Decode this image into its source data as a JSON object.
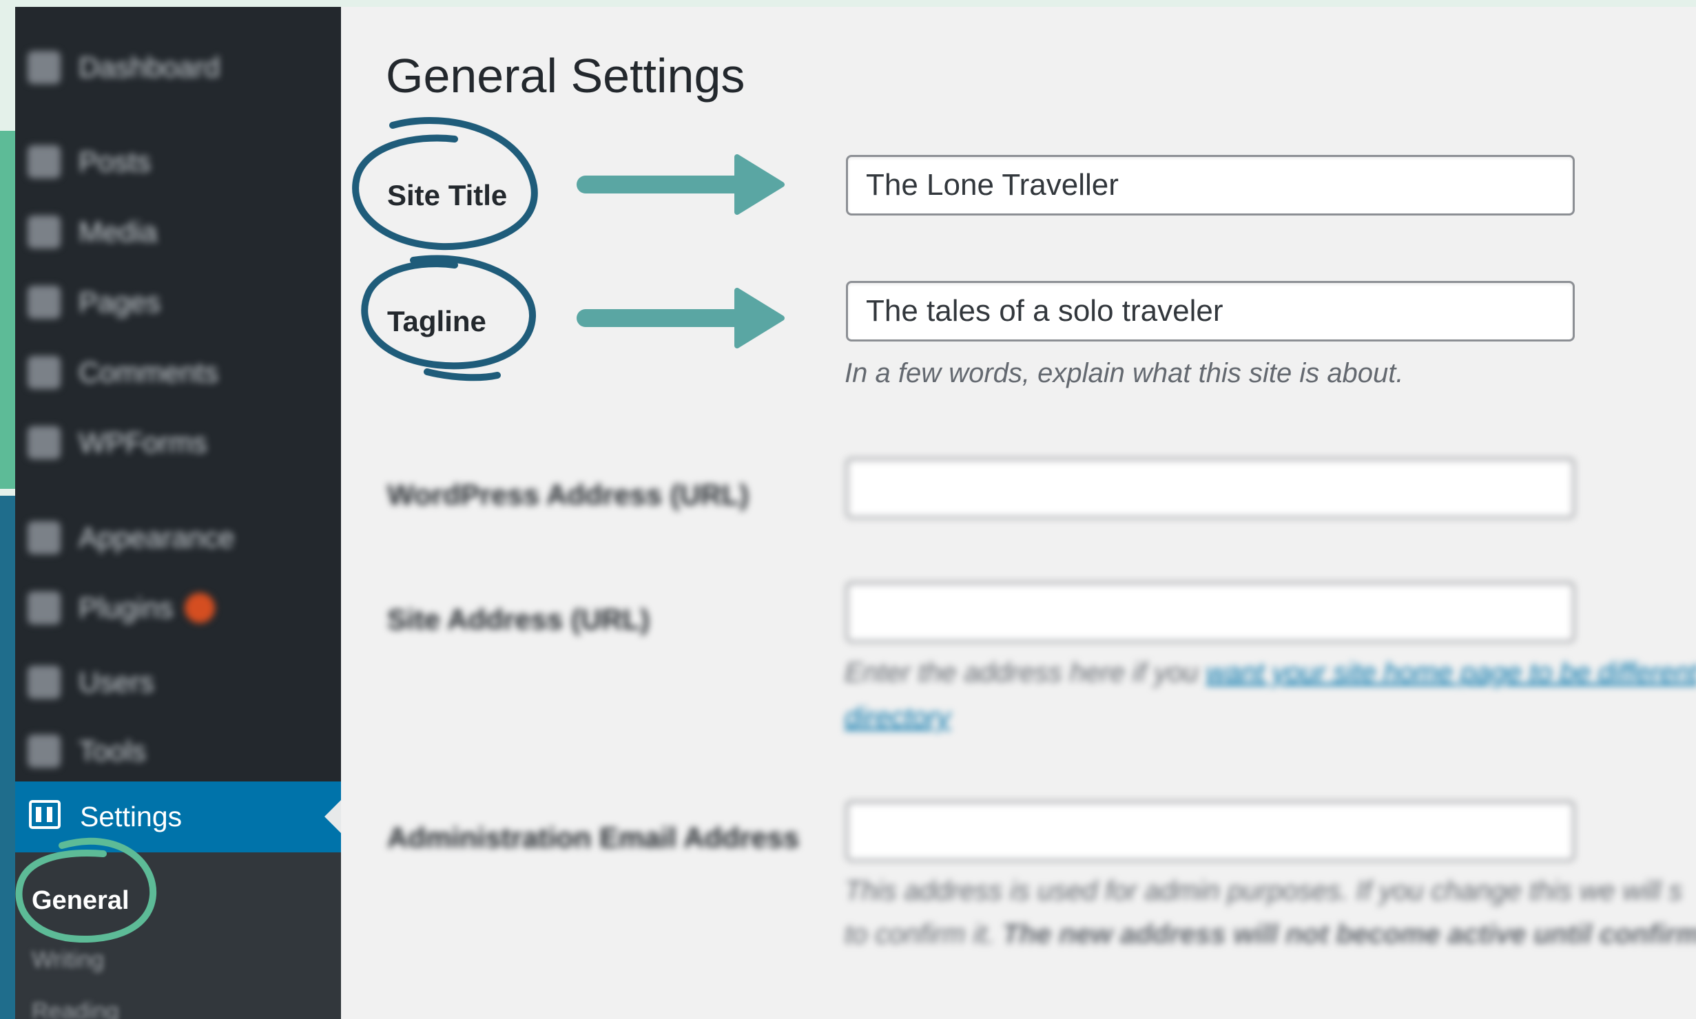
{
  "sidebar": {
    "items": [
      {
        "label": "Dashboard",
        "icon": "dashboard-icon"
      },
      {
        "label": "Posts",
        "icon": "pin-icon"
      },
      {
        "label": "Media",
        "icon": "media-icon"
      },
      {
        "label": "Pages",
        "icon": "pages-icon"
      },
      {
        "label": "Comments",
        "icon": "comment-icon"
      },
      {
        "label": "WPForms",
        "icon": "form-icon"
      },
      {
        "label": "Appearance",
        "icon": "brush-icon"
      },
      {
        "label": "Plugins",
        "icon": "plug-icon"
      },
      {
        "label": "Users",
        "icon": "user-icon"
      },
      {
        "label": "Tools",
        "icon": "wrench-icon"
      }
    ],
    "active_item": {
      "label": "Settings",
      "icon": "settings-icon"
    },
    "submenu": [
      {
        "label": "General"
      },
      {
        "label": "Writing"
      },
      {
        "label": "Reading"
      }
    ]
  },
  "main": {
    "title": "General Settings",
    "fields": {
      "site_title": {
        "label": "Site Title",
        "value": "The Lone Traveller"
      },
      "tagline": {
        "label": "Tagline",
        "value": "The tales of a solo traveler",
        "hint": "In a few words, explain what this site is about."
      },
      "wordpress_address": {
        "label": "WordPress Address (URL)"
      },
      "site_address": {
        "label": "Site Address (URL)",
        "hint_text": "Enter the address here if you",
        "hint_link": "want your site home page to be different",
        "hint_link2": "directory"
      },
      "admin_email": {
        "label": "Administration Email Address",
        "hint_line1": "This address is used for admin purposes. If you change this we will s",
        "hint_line2a": "to confirm it.",
        "hint_line2b": "The new address will not become active until confirm"
      }
    }
  },
  "annotation_colors": {
    "circle_navy": "#1f5c7a",
    "arrow_teal": "#5aa6a3",
    "circle_green": "#5dbb97"
  }
}
